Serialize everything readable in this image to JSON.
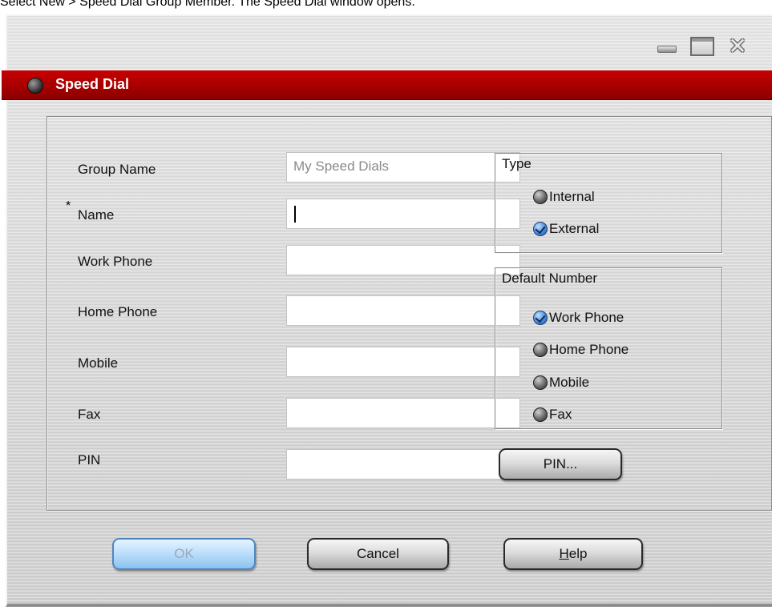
{
  "caption": "Select New > Speed Dial Group Member. The Speed Dial window opens.",
  "window": {
    "title": "Speed Dial",
    "controls": {
      "minimize_icon": "minimize-icon",
      "maximize_icon": "maximize-icon",
      "close_icon": "close-icon",
      "close_glyph": "✕"
    }
  },
  "form": {
    "required_marker": "*",
    "group_name": {
      "label": "Group Name",
      "value": "My Speed Dials"
    },
    "name": {
      "label": "Name",
      "value": ""
    },
    "work_phone": {
      "label": "Work Phone",
      "value": ""
    },
    "home_phone": {
      "label": "Home Phone",
      "value": ""
    },
    "mobile": {
      "label": "Mobile",
      "value": ""
    },
    "fax": {
      "label": "Fax",
      "value": ""
    },
    "pin": {
      "label": "PIN",
      "value": ""
    }
  },
  "type_group": {
    "title": "Type",
    "options": [
      {
        "label": "Internal",
        "checked": false
      },
      {
        "label": "External",
        "checked": true
      }
    ]
  },
  "default_number_group": {
    "title": "Default Number",
    "options": [
      {
        "label": "Work Phone",
        "checked": true
      },
      {
        "label": "Home Phone",
        "checked": false
      },
      {
        "label": "Mobile",
        "checked": false
      },
      {
        "label": "Fax",
        "checked": false
      }
    ]
  },
  "buttons": {
    "pin": "PIN...",
    "ok": "OK",
    "cancel": "Cancel",
    "help_mnemonic": "H",
    "help_rest": "elp"
  },
  "colors": {
    "title_bar": "#b00000",
    "ok_button": "#b9ddfb",
    "radio_checked": "#4a8ddb"
  }
}
